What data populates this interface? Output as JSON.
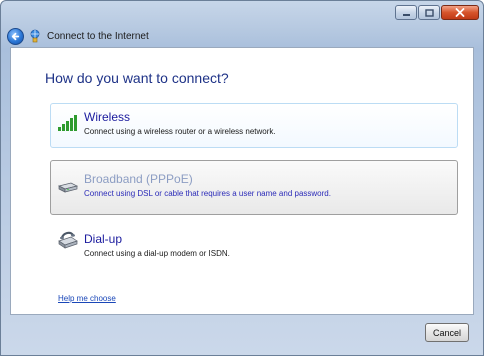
{
  "window": {
    "title": "Connect to the Internet"
  },
  "page": {
    "heading": "How do you want to connect?"
  },
  "options": [
    {
      "title": "Wireless",
      "description": "Connect using a wireless router or a wireless network.",
      "icon": "wireless-signal-icon",
      "state": "enabled"
    },
    {
      "title": "Broadband (PPPoE)",
      "description": "Connect using DSL or cable that requires a user name and password.",
      "icon": "broadband-modem-icon",
      "state": "selected"
    },
    {
      "title": "Dial-up",
      "description": "Connect using a dial-up modem or ISDN.",
      "icon": "dialup-modem-icon",
      "state": "enabled"
    }
  ],
  "help_link": "Help me choose",
  "buttons": {
    "cancel": "Cancel"
  },
  "colors": {
    "heading": "#1e3287",
    "link": "#1a47b8",
    "selected_option_border": "#9f9f9f",
    "hover_option_border": "#bcdcf4"
  }
}
